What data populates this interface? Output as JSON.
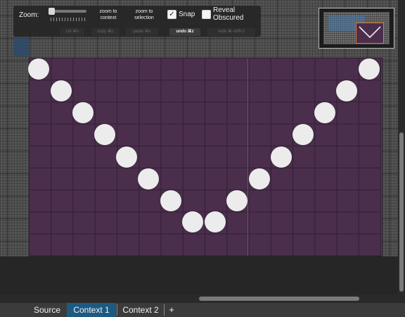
{
  "toolbar": {
    "zoom_label": "Zoom:",
    "zoom_to_context": "zoom to\ncontext",
    "zoom_to_selection": "zoom to\nselection",
    "snap_label": "Snap",
    "snap_checked": true,
    "reveal_label": "Reveal\nObscured",
    "reveal_checked": false,
    "cut": "cut ⌘x",
    "copy": "copy ⌘c",
    "paste": "paste ⌘v",
    "undo": "undo ⌘z",
    "redo": "redo ⌘-shift-z"
  },
  "tabs": {
    "source": "Source",
    "context1": "Context 1",
    "context2": "Context 2",
    "add": "+",
    "active": "Context 1"
  },
  "colors": {
    "canvas": "#4a2e4c",
    "dot": "#ececec",
    "active_tab": "#1d5a82",
    "minimap_border": "#e07a2a"
  },
  "icons": {
    "add_tab": "plus-icon",
    "check": "checkmark-icon"
  }
}
